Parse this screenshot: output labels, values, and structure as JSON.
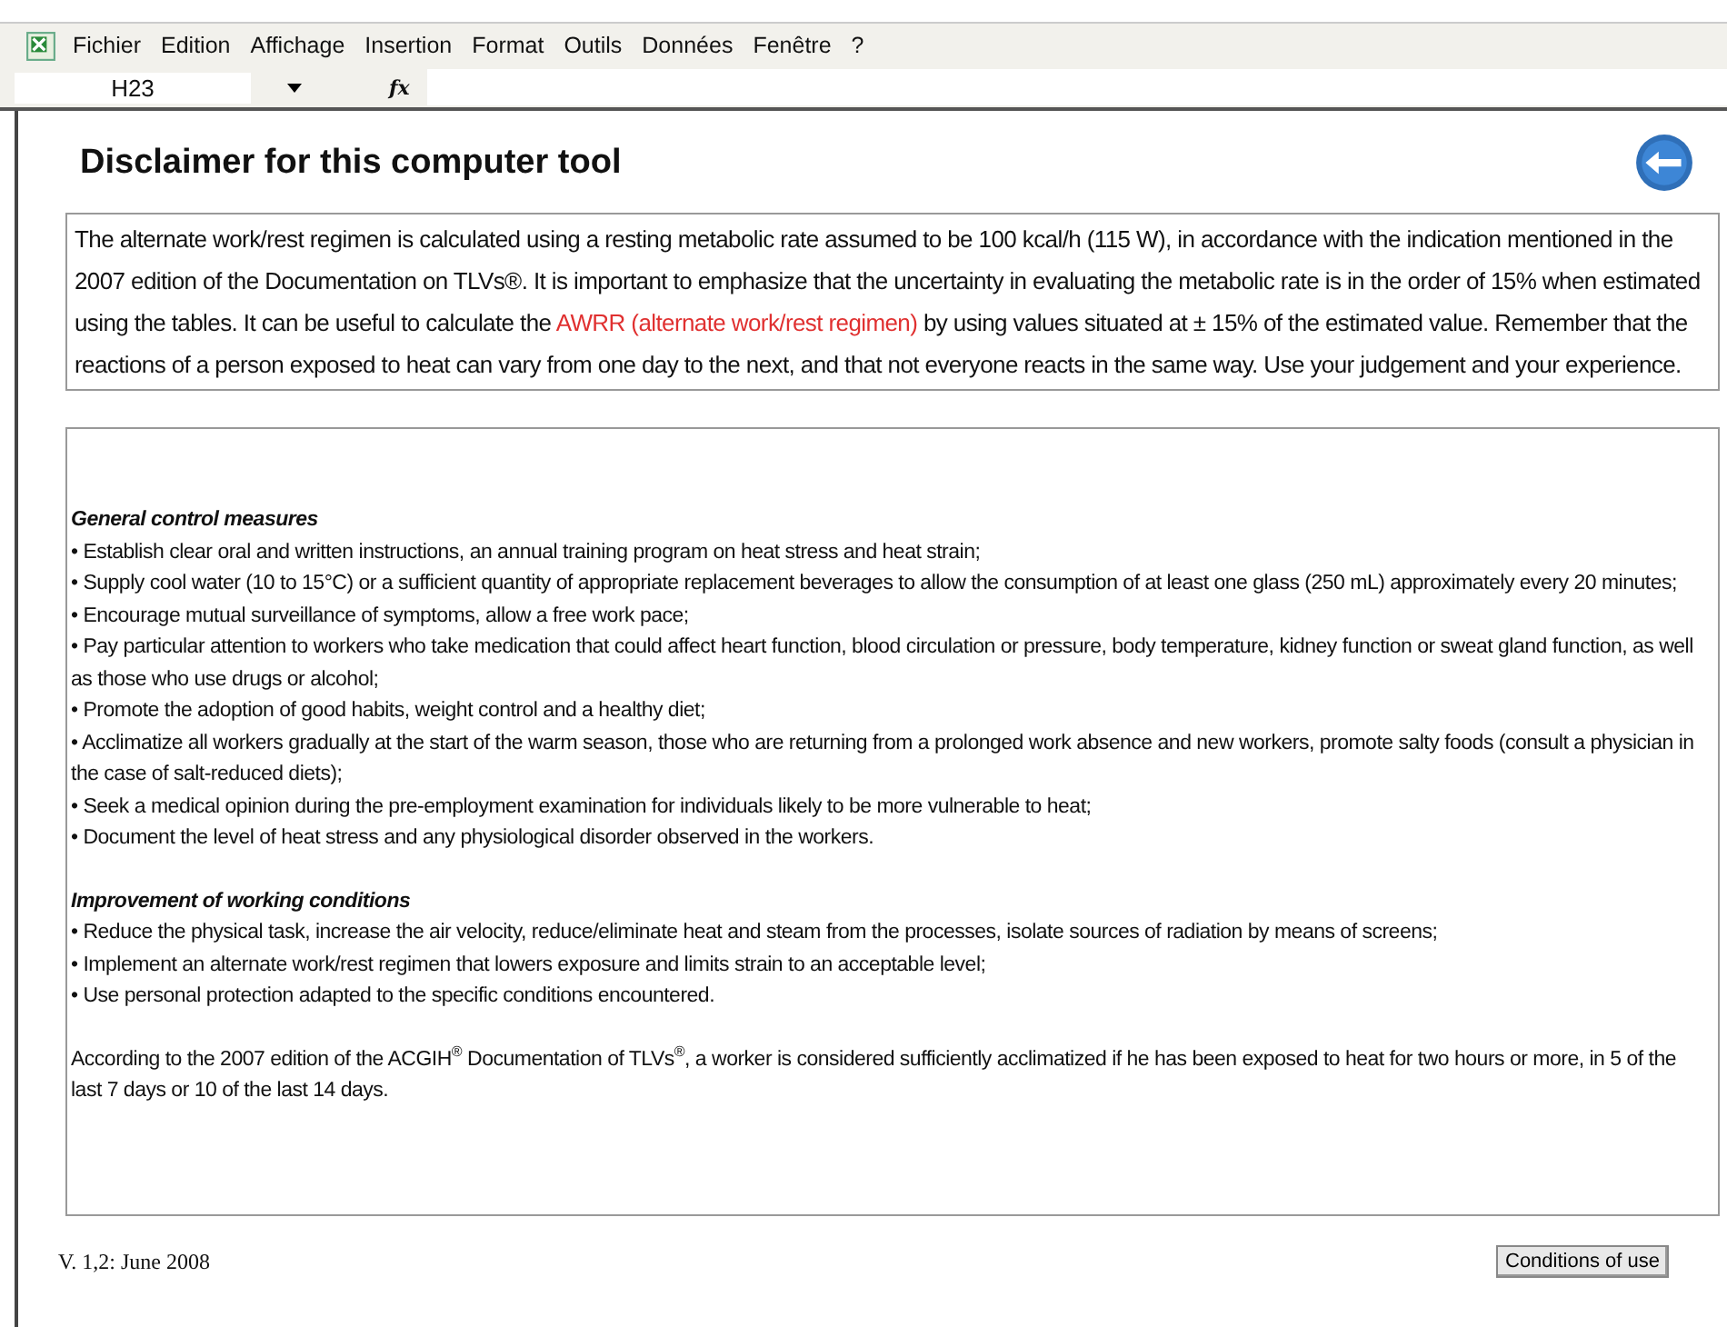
{
  "menu_bar": {
    "items": [
      "Fichier",
      "Edition",
      "Affichage",
      "Insertion",
      "Format",
      "Outils",
      "Données",
      "Fenêtre",
      "?"
    ]
  },
  "formula_bar": {
    "cell_reference": "H23",
    "function_label": "fx"
  },
  "title": "Disclaimer for this computer tool",
  "intro": {
    "before": "The alternate work/rest regimen is calculated using a resting metabolic rate assumed to be 100 kcal/h (115 W), in accordance with the indication mentioned in the 2007 edition of the Documentation on TLVs®. It is important to emphasize that the uncertainty in evaluating the metabolic rate is in the order of 15% when estimated using the tables. It can be useful to calculate the",
    "link": "AWRR (alternate work/rest regimen)",
    "after": "by using values situated at ± 15% of the estimated value.  Remember that the reactions of a person exposed to heat can vary from one day to the next, and that not everyone reacts in the same way.  Use your judgement and your experience."
  },
  "sections": [
    {
      "heading": "General control measures",
      "items": [
        "• Establish clear oral and written instructions, an annual training program on heat stress and heat strain;",
        "• Supply cool water (10 to 15°C) or a sufficient quantity of appropriate replacement beverages to allow the consumption of at least one glass (250 mL) approximately every 20 minutes;",
        "• Encourage mutual surveillance of symptoms, allow a free work pace;",
        "• Pay particular attention to workers who take medication that could affect heart function, blood circulation or pressure, body temperature, kidney function or sweat gland function, as well as those who use drugs or alcohol;",
        "• Promote the adoption of good habits, weight control and a healthy diet;",
        "• Acclimatize all workers gradually at the start of the warm season, those who are returning from a prolonged work absence and new workers, promote salty foods (consult a physician in the case of salt-reduced diets);",
        "• Seek a medical opinion during the pre-employment examination for individuals likely to be more vulnerable to heat;",
        "• Document the level of heat stress and any physiological disorder observed in the workers."
      ]
    },
    {
      "heading": "Improvement of working conditions",
      "items": [
        "• Reduce the physical task, increase the air velocity, reduce/eliminate heat and steam from the processes, isolate sources of radiation by means of screens;",
        "• Implement an alternate work/rest regimen that lowers exposure and limits strain to an acceptable level;",
        "• Use personal protection adapted to the specific conditions encountered."
      ]
    }
  ],
  "note": "According to the 2007 edition of the ACGIH$^{®}$ Documentation of TLVs$^{®}$, a worker is considered sufficiently acclimatized if he has been exposed to heat for two hours or more, in 5 of the last 7 days or 10 of the last 14 days.",
  "footer": {
    "version": "V. 1,2: June 2008",
    "button": "Conditions of use"
  }
}
